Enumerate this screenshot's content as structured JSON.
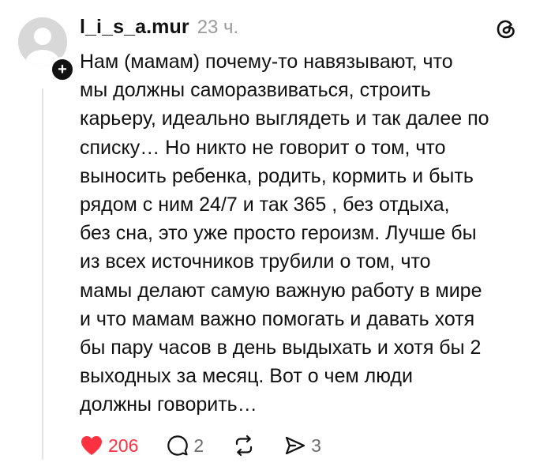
{
  "post": {
    "username": "l_i_s_a.mur",
    "timestamp": "23 ч.",
    "text": "Нам (мамам) почему-то навязывают, что\nмы должны саморазвиваться, строить\nкарьеру, идеально выглядеть и так далее по\nсписку… Но никто не говорит о том, что\nвыносить ребенка, родить, кормить и быть\nрядом с ним 24/7 и так 365 , без отдыха,\nбез сна, это уже просто героизм. Лучше бы\nиз всех источников трубили о том, что\nмамы делают самую важную работу в мире\nи что мамам важно помогать и давать хотя\nбы пару часов в день выдыхать и хотя бы 2\nвыходных за месяц. Вот о чем люди\nдолжны говорить…"
  },
  "avatar": {
    "badge_symbol": "+"
  },
  "actions": {
    "likes": "206",
    "liked": true,
    "replies": "2",
    "shares": "3"
  },
  "icons": {
    "like": "heart-icon",
    "reply": "speech-bubble-icon",
    "repost": "repost-icon",
    "share": "send-icon",
    "app": "threads-logo-icon",
    "follow": "plus-icon"
  },
  "colors": {
    "like_active": "#ff3040",
    "text": "#111111",
    "muted": "#9a9a9a",
    "avatar_bg": "#d8d8d8"
  }
}
